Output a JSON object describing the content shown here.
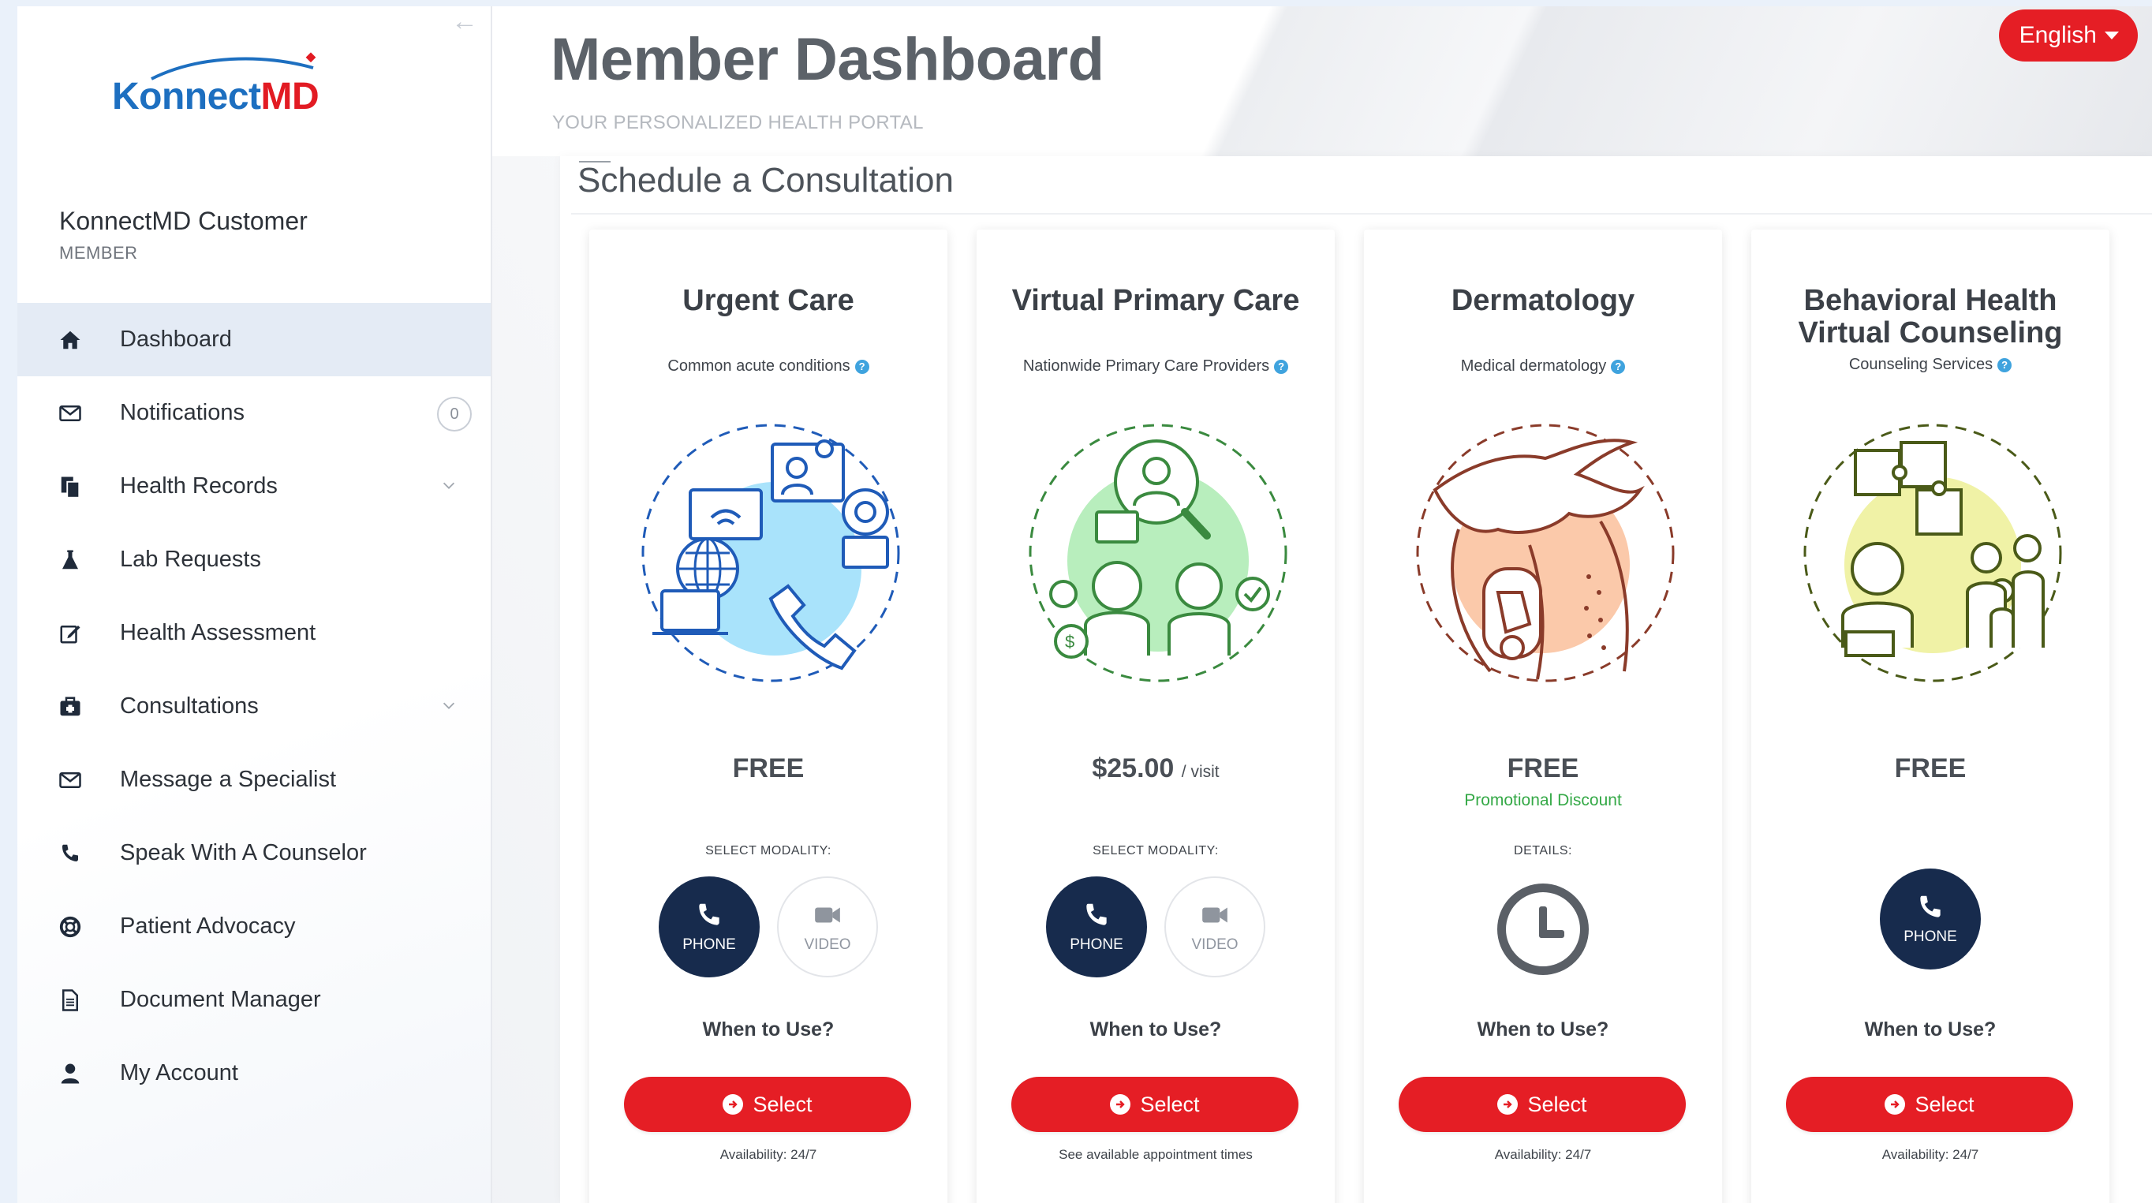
{
  "brand": {
    "logo_text_main": "Konnect",
    "logo_text_accent": "MD"
  },
  "user": {
    "name": "KonnectMD Customer",
    "role": "MEMBER"
  },
  "language": {
    "label": "English"
  },
  "page": {
    "title": "Member Dashboard",
    "subtitle": "YOUR PERSONALIZED HEALTH PORTAL"
  },
  "section": {
    "title": "Schedule a Consultation"
  },
  "nav": {
    "items": [
      {
        "label": "Dashboard",
        "icon": "home-icon",
        "active": true
      },
      {
        "label": "Notifications",
        "icon": "envelope-icon",
        "count": "0"
      },
      {
        "label": "Health Records",
        "icon": "files-icon",
        "expandable": true
      },
      {
        "label": "Lab Requests",
        "icon": "flask-icon"
      },
      {
        "label": "Health Assessment",
        "icon": "edit-icon"
      },
      {
        "label": "Consultations",
        "icon": "medkit-icon",
        "expandable": true
      },
      {
        "label": "Message a Specialist",
        "icon": "envelope-icon"
      },
      {
        "label": "Speak With A Counselor",
        "icon": "phone-icon"
      },
      {
        "label": "Patient Advocacy",
        "icon": "lifebuoy-icon"
      },
      {
        "label": "Document Manager",
        "icon": "document-icon"
      },
      {
        "label": "My Account",
        "icon": "user-icon"
      }
    ]
  },
  "cards": [
    {
      "title": "Urgent Care",
      "subtitle": "Common acute conditions",
      "price": "FREE",
      "modality_label": "SELECT MODALITY:",
      "phone_label": "PHONE",
      "video_label": "VIDEO",
      "when_label": "When to Use?",
      "select_label": "Select",
      "availability": "Availability: 24/7",
      "accent": "#7fd4f7"
    },
    {
      "title": "Virtual Primary Care",
      "subtitle": "Nationwide Primary Care Providers",
      "price": "$25.00",
      "price_unit": "/ visit",
      "modality_label": "SELECT MODALITY:",
      "phone_label": "PHONE",
      "video_label": "VIDEO",
      "when_label": "When to Use?",
      "select_label": "Select",
      "availability": "See available appointment times",
      "accent": "#9ee6a3"
    },
    {
      "title": "Dermatology",
      "subtitle": "Medical dermatology",
      "price": "FREE",
      "promo": "Promotional Discount",
      "modality_label": "DETAILS:",
      "when_label": "When to Use?",
      "select_label": "Select",
      "availability": "Availability: 24/7",
      "accent": "#f9c5a4"
    },
    {
      "title_line1": "Behavioral Health",
      "title_line2": "Virtual Counseling",
      "subtitle": "Counseling Services",
      "price": "FREE",
      "phone_label": "PHONE",
      "when_label": "When to Use?",
      "select_label": "Select",
      "availability": "Availability: 24/7",
      "accent": "#eef0a0"
    }
  ],
  "colors": {
    "primary_red": "#e51e25",
    "navy": "#172b4d",
    "brand_blue": "#1d6fc0"
  }
}
